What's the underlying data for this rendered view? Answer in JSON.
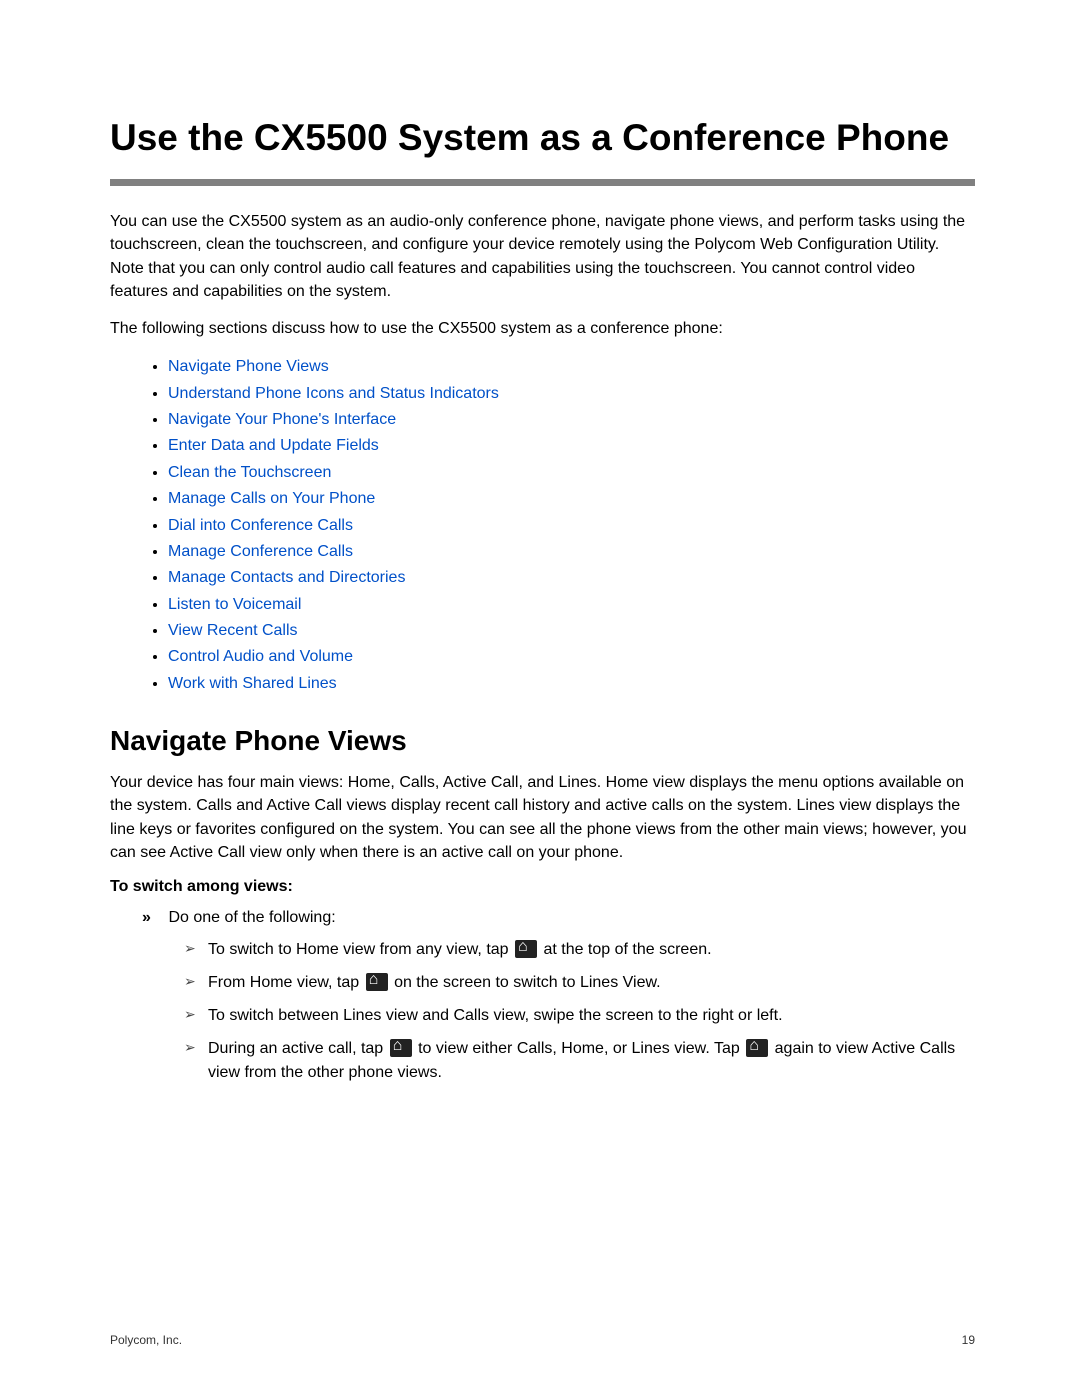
{
  "title": "Use the CX5500 System as a Conference Phone",
  "intro": "You can use the CX5500 system as an audio-only conference phone, navigate phone views, and perform tasks using the touchscreen, clean the touchscreen, and configure your device remotely using the Polycom Web Configuration Utility. Note that you can only control audio call features and capabilities using the touchscreen. You cannot control video features and capabilities on the system.",
  "following_text": "The following sections discuss how to use the CX5500 system as a conference phone:",
  "links": [
    "Navigate Phone Views",
    "Understand Phone Icons and Status Indicators",
    "Navigate Your Phone's Interface",
    "Enter Data and Update Fields",
    "Clean the Touchscreen",
    "Manage Calls on Your Phone",
    "Dial into Conference Calls",
    "Manage Conference Calls",
    "Manage Contacts and Directories",
    "Listen to Voicemail",
    "View Recent Calls",
    "Control Audio and Volume",
    "Work with Shared Lines"
  ],
  "section_heading": "Navigate Phone Views",
  "section_body": "Your device has four main views: Home, Calls, Active Call, and Lines. Home view displays the menu options available on the system. Calls and Active Call views display recent call history and active calls on the system. Lines view displays the line keys or favorites configured on the system. You can see all the phone views from the other main views; however, you can see Active Call view only when there is an active call on your phone.",
  "switch_heading": "To switch among views:",
  "step_intro": "Do one of the following:",
  "steps": {
    "s1a": "To switch to Home view from any view, tap ",
    "s1b": " at the top of the screen.",
    "s2a": "From Home view, tap ",
    "s2b": " on the screen to switch to Lines View.",
    "s3": "To switch between Lines view and Calls view, swipe the screen to the right or left.",
    "s4a": "During an active call, tap ",
    "s4b": " to view either Calls, Home, or Lines view. Tap ",
    "s4c": " again to view Active Calls view from the other phone views."
  },
  "footer_left": "Polycom, Inc.",
  "footer_right": "19"
}
